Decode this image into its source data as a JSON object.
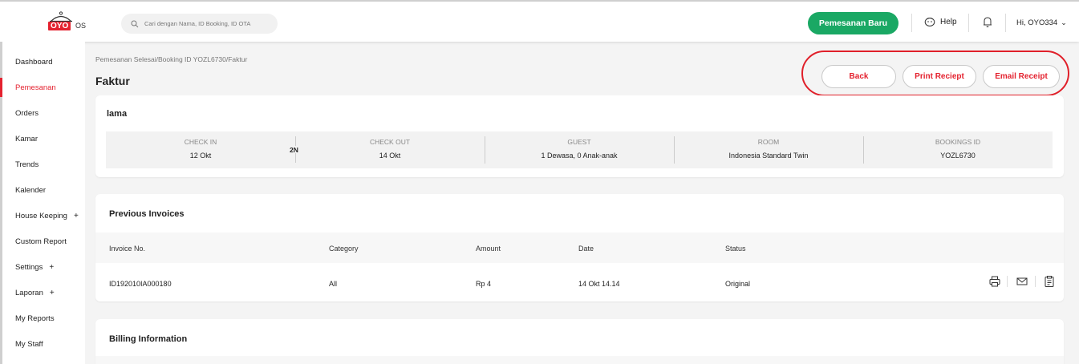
{
  "header": {
    "brand": "OYO",
    "brand_suffix": "OS",
    "search_placeholder": "Cari dengan Nama, ID Booking, ID OTA",
    "new_booking_label": "Pemesanan Baru",
    "help_label": "Help",
    "user_label": "Hi, OYO334",
    "colors": {
      "accent": "#e4222f",
      "primary_button": "#1aa864"
    }
  },
  "sidebar": {
    "items": [
      {
        "label": "Dashboard",
        "active": false,
        "expandable": false
      },
      {
        "label": "Pemesanan",
        "active": true,
        "expandable": false
      },
      {
        "label": "Orders",
        "active": false,
        "expandable": false
      },
      {
        "label": "Kamar",
        "active": false,
        "expandable": false
      },
      {
        "label": "Trends",
        "active": false,
        "expandable": false
      },
      {
        "label": "Kalender",
        "active": false,
        "expandable": false
      },
      {
        "label": "House Keeping",
        "active": false,
        "expandable": true
      },
      {
        "label": "Custom Report",
        "active": false,
        "expandable": false
      },
      {
        "label": "Settings",
        "active": false,
        "expandable": true
      },
      {
        "label": "Laporan",
        "active": false,
        "expandable": true
      },
      {
        "label": "My Reports",
        "active": false,
        "expandable": false
      },
      {
        "label": "My Staff",
        "active": false,
        "expandable": false
      }
    ],
    "expand_symbol": "+"
  },
  "page": {
    "breadcrumb": "Pemesanan Selesai/Booking ID YOZL6730/Faktur",
    "title": "Faktur",
    "actions": {
      "back": "Back",
      "print": "Print Reciept",
      "email": "Email Receipt"
    }
  },
  "booking": {
    "guest_name": "lama",
    "check_in_label": "CHECK IN",
    "check_in": "12 Okt",
    "nights": "2N",
    "check_out_label": "CHECK OUT",
    "check_out": "14 Okt",
    "guest_label": "GUEST",
    "guest": "1 Dewasa, 0 Anak-anak",
    "room_label": "ROOM",
    "room": "Indonesia Standard Twin",
    "booking_id_label": "BOOKINGS ID",
    "booking_id": "YOZL6730"
  },
  "invoices": {
    "title": "Previous Invoices",
    "columns": [
      "Invoice No.",
      "Category",
      "Amount",
      "Date",
      "Status"
    ],
    "rows": [
      {
        "invoice_no": "ID192010IA000180",
        "category": "All",
        "amount": "Rp 4",
        "date": "14 Okt 14.14",
        "status": "Original",
        "icons": [
          "print-icon",
          "mail-icon",
          "document-icon"
        ]
      }
    ]
  },
  "billing": {
    "title": "Billing Information"
  }
}
